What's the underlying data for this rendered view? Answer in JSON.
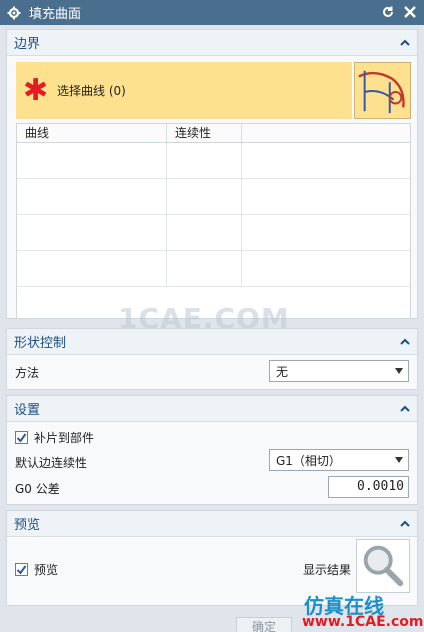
{
  "window": {
    "title": "填充曲面"
  },
  "boundary": {
    "header": "边界",
    "select_curve": "选择曲线 (0)",
    "table_headers": [
      "曲线",
      "连续性"
    ],
    "rows": 4
  },
  "shape": {
    "header": "形状控制",
    "method_label": "方法",
    "method_value": "无"
  },
  "settings": {
    "header": "设置",
    "patch_label": "补片到部件",
    "default_edge_label": "默认边连续性",
    "default_edge_value": "G1（相切）",
    "g0_label": "G0 公差",
    "g0_value": "0.0010"
  },
  "preview": {
    "header": "预览",
    "preview_label": "预览",
    "show_result": "显示结果"
  },
  "footer": {
    "ok_label": "确定"
  },
  "watermarks": {
    "center": "1CAE.COM",
    "brand": "仿真在线",
    "url": "www.1CAE.com"
  },
  "colors": {
    "titlebar": "#4a6e8e",
    "section_header_text": "#1f4f80",
    "selection_bg": "#fde18e",
    "required_star": "#e31b23"
  }
}
